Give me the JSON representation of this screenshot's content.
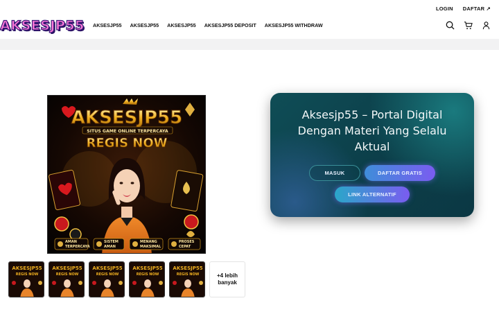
{
  "top_links": {
    "login": "LOGIN",
    "daftar": "DAFTAR"
  },
  "logo": {
    "text": "AKSESJP55"
  },
  "nav": {
    "items": [
      "AKSESJP55",
      "AKSESJP55",
      "AKSESJP55",
      "AKSESJP55 DEPOSIT",
      "AKSESJP55 WITHDRAW"
    ]
  },
  "header_icons": [
    "search-icon",
    "cart-icon",
    "user-icon"
  ],
  "product_image": {
    "brand": "AKSESJP55",
    "tagline": "SITUS GAME ONLINE TERPERCAYA",
    "cta": "REGIS NOW",
    "badges": [
      "AMAN TERPERCAYA",
      "SISTEM AMAN",
      "MENANG MAKSIMAL",
      "PROSES CEPAT"
    ]
  },
  "thumbnails": {
    "count": 5,
    "more_label": "+4 lebih banyak"
  },
  "card": {
    "title": "Aksesjp55 – Portal Digital Dengan Materi Yang Selalu Aktual",
    "masuk": "MASUK",
    "daftar_gratis": "DAFTAR GRATIS",
    "link_alternatif": "LINK ALTERNATIF"
  },
  "colors": {
    "card_bg": "#0c3e49",
    "button_gradient_start": "#3f8dd9",
    "button_gradient_end": "#7a5cf0",
    "band": "#f2f2f3"
  }
}
